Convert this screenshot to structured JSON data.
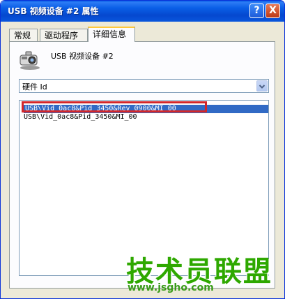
{
  "window": {
    "title": "USB 视频设备 #2 属性",
    "help_label": "?",
    "close_label": "X"
  },
  "tabs": [
    {
      "label": "常规"
    },
    {
      "label": "驱动程序"
    },
    {
      "label": "详细信息"
    }
  ],
  "device": {
    "name": "USB 视频设备 #2",
    "icon": "camera-icon"
  },
  "property_select": {
    "value": "硬件 Id"
  },
  "hardware_ids": [
    "USB\\Vid_0ac8&Pid_3450&Rev_0900&MI_00",
    "USB\\Vid_0ac8&Pid_3450&MI_00"
  ],
  "watermark": {
    "text": "技术员联盟",
    "url": "www.jsgho.com"
  },
  "colors": {
    "titlebar": "#0a5ee6",
    "selection": "#316ac5",
    "highlight": "#d3272a",
    "watermark": "#2ea800"
  }
}
